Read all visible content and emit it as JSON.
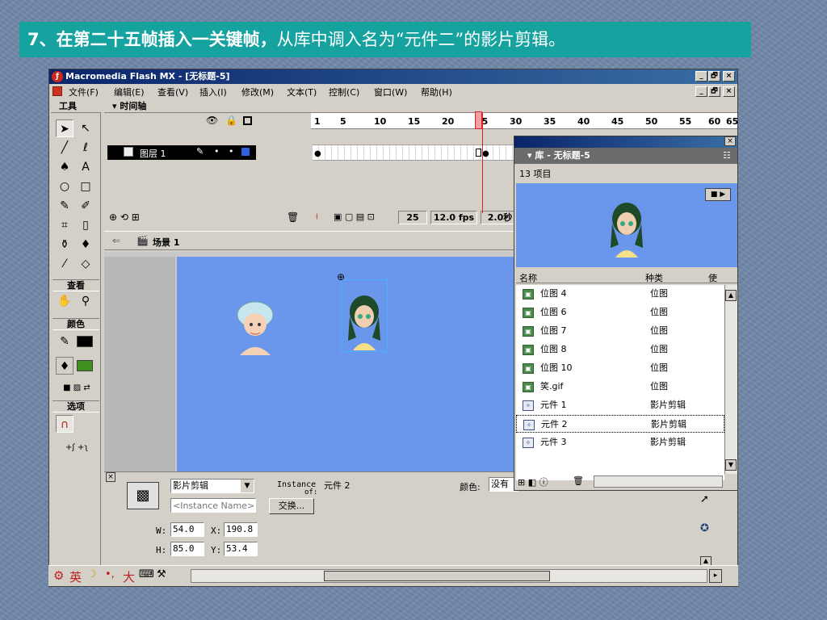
{
  "caption": {
    "lead": "7、在第二十五帧插入一关键帧，",
    "rest": "从库中调入名为“元件二”的影片剪辑。"
  },
  "window": {
    "title": "Macromedia Flash MX - [无标题-5]",
    "min": "_",
    "max": "🗗",
    "close": "×"
  },
  "menu": {
    "items": [
      "文件(F)",
      "编辑(E)",
      "查看(V)",
      "插入(I)",
      "修改(M)",
      "文本(T)",
      "控制(C)",
      "窗口(W)",
      "帮助(H)"
    ]
  },
  "toolbox": {
    "title": "工具",
    "view_label": "查看",
    "colors_label": "颜色",
    "options_label": "选项",
    "stroke_color": "#000000",
    "fill_color": "#3f8f1f"
  },
  "timeline": {
    "title": "时间轴",
    "ticks": [
      "1",
      "5",
      "10",
      "15",
      "20",
      "25",
      "30",
      "35",
      "40",
      "45",
      "50",
      "55",
      "60",
      "65"
    ],
    "layer_name": "图层 1",
    "current_frame": "25",
    "fps": "12.0 fps",
    "time": "2.0秒"
  },
  "scene": {
    "label": "场景 1"
  },
  "props": {
    "type": "影片剪辑",
    "instance_label": "Instance",
    "instance_of": "of:",
    "symbol": "元件 2",
    "instance_placeholder": "<Instance Name>",
    "swap_button": "交换...",
    "w_label": "W:",
    "w": "54.0",
    "x_label": "X:",
    "x": "190.8",
    "h_label": "H:",
    "h": "85.0",
    "y_label": "Y:",
    "y": "53.4",
    "color_label": "颜色:",
    "color_value": "没有"
  },
  "library": {
    "title": "库 - 无标题-5",
    "count": "13 项目",
    "col_name": "名称",
    "col_kind": "种类",
    "col_use": "使",
    "items": [
      {
        "name": "位图 4",
        "kind": "位图"
      },
      {
        "name": "位图 6",
        "kind": "位图"
      },
      {
        "name": "位图 7",
        "kind": "位图"
      },
      {
        "name": "位图 8",
        "kind": "位图"
      },
      {
        "name": "位图 10",
        "kind": "位图"
      },
      {
        "name": "笑.gif",
        "kind": "位图"
      },
      {
        "name": "元件 1",
        "kind": "影片剪辑"
      },
      {
        "name": "元件 2",
        "kind": "影片剪辑"
      },
      {
        "name": "元件 3",
        "kind": "影片剪辑"
      }
    ]
  },
  "taskbar": {
    "ime": "英",
    "full": "大"
  }
}
